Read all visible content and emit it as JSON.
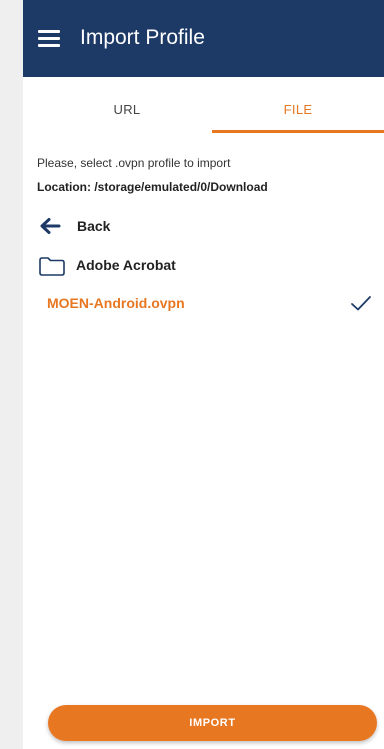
{
  "app_bar": {
    "title": "Import Profile",
    "menu_icon": "menu-icon",
    "background": "#1d3a67"
  },
  "tabs": [
    {
      "label": "URL",
      "selected": false
    },
    {
      "label": "FILE",
      "selected": true
    }
  ],
  "accent_color": "#e87722",
  "file_browser": {
    "instructions": "Please, select .ovpn profile to import",
    "location": "Location: /storage/emulated/0/Download",
    "back": {
      "label": "Back",
      "icon": "arrow-left-icon"
    },
    "items": [
      {
        "type": "folder",
        "label": "Adobe Acrobat",
        "icon": "folder-icon"
      },
      {
        "type": "file",
        "label": "MOEN-Android.ovpn",
        "selected": true,
        "icon": "checkmark-icon"
      }
    ]
  },
  "import_button": {
    "label": "IMPORT"
  }
}
